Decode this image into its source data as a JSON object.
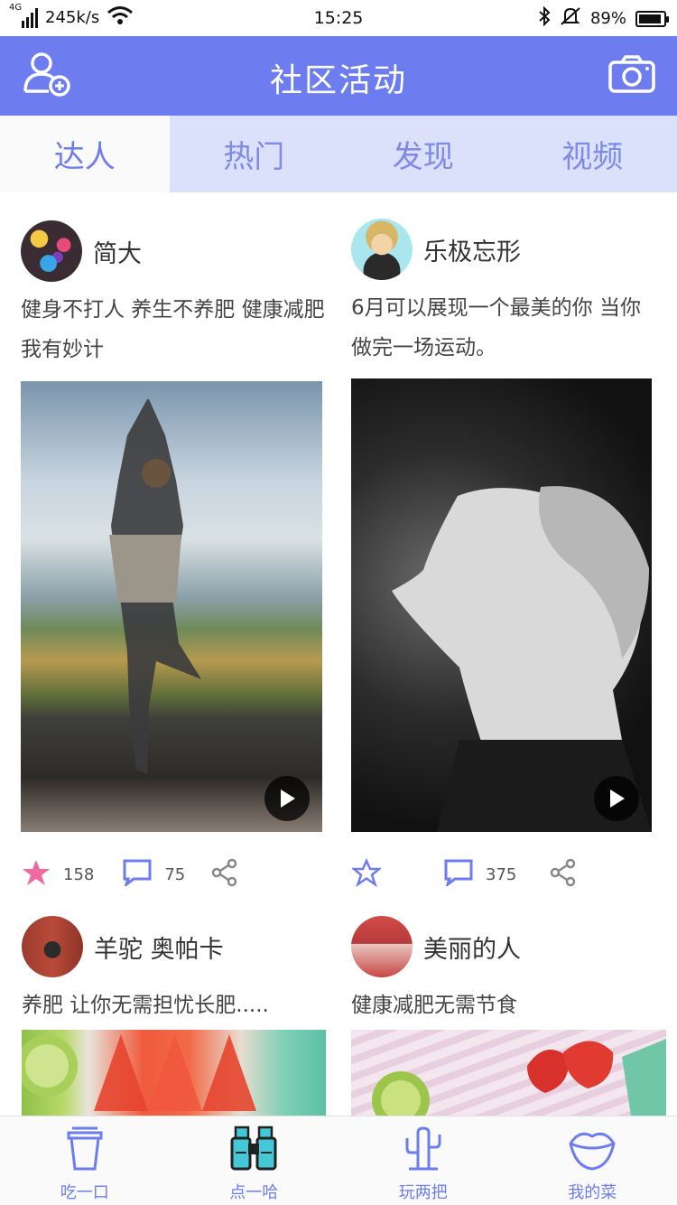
{
  "status": {
    "network": "4G",
    "speed": "245k/s",
    "time": "15:25",
    "battery": "89%",
    "battery_level": 0.89
  },
  "header": {
    "title": "社区活动",
    "left_icon": "add-friend-icon",
    "right_icon": "camera-icon"
  },
  "tabs": [
    {
      "label": "达人",
      "active": true
    },
    {
      "label": "热门",
      "active": false
    },
    {
      "label": "发现",
      "active": false
    },
    {
      "label": "视频",
      "active": false
    }
  ],
  "posts": [
    {
      "user": "简大",
      "text": "健身不打人 养生不养肥  健康减肥我有妙计",
      "likes": "158",
      "comments": "75",
      "liked": true
    },
    {
      "user": "乐极忘形",
      "text": "6月可以展现一个最美的你 当你做完一场运动。",
      "likes": "",
      "comments": "375",
      "liked": false
    },
    {
      "user": "羊驼 奥帕卡",
      "text": "养肥 让你无需担忧长肥.....",
      "likes": "",
      "comments": "",
      "liked": false
    },
    {
      "user": "美丽的人",
      "text": "健康减肥无需节食",
      "likes": "",
      "comments": "",
      "liked": false
    }
  ],
  "nav": [
    {
      "label": "吃一口",
      "icon": "cup-icon"
    },
    {
      "label": "点一哈",
      "icon": "binoculars-icon"
    },
    {
      "label": "玩两把",
      "icon": "cactus-icon"
    },
    {
      "label": "我的菜",
      "icon": "lips-icon"
    }
  ],
  "colors": {
    "accent": "#6d7df0",
    "tab_bg": "#dce1fb",
    "star": "#ef6aa0"
  }
}
